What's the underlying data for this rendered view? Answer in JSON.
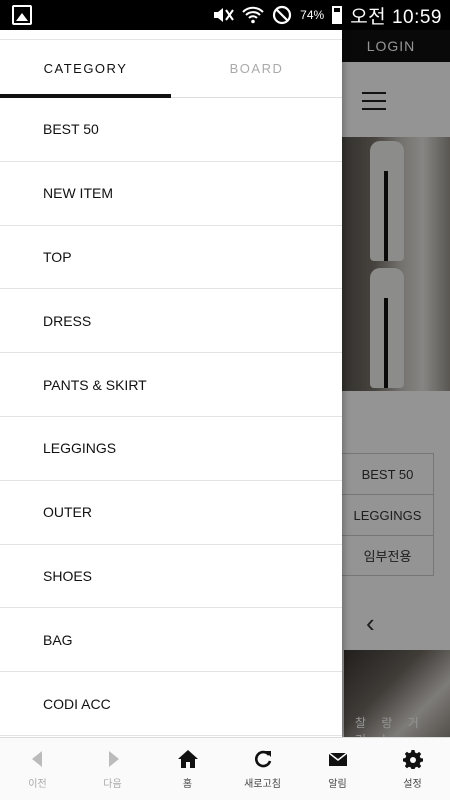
{
  "status_bar": {
    "battery_pct": "74%",
    "time": "오전 10:59"
  },
  "background_page": {
    "login_label": "LOGIN",
    "categories": [
      "BEST 50",
      "LEGGINGS",
      "임부전용"
    ],
    "banner_text": "찰 랑 거 리 는"
  },
  "drawer": {
    "tabs": [
      {
        "label": "CATEGORY",
        "active": true
      },
      {
        "label": "BOARD",
        "active": false
      }
    ],
    "items": [
      {
        "label": "BEST 50"
      },
      {
        "label": "NEW ITEM"
      },
      {
        "label": "TOP"
      },
      {
        "label": "DRESS"
      },
      {
        "label": "PANTS & SKIRT"
      },
      {
        "label": "LEGGINGS"
      },
      {
        "label": "OUTER"
      },
      {
        "label": "SHOES"
      },
      {
        "label": "BAG"
      },
      {
        "label": "CODI ACC"
      }
    ]
  },
  "bottom_nav": {
    "items": [
      {
        "label": "이전",
        "icon": "back-arrow-icon"
      },
      {
        "label": "다음",
        "icon": "forward-arrow-icon"
      },
      {
        "label": "홈",
        "icon": "home-icon"
      },
      {
        "label": "새로고침",
        "icon": "refresh-icon"
      },
      {
        "label": "알림",
        "icon": "mail-icon"
      },
      {
        "label": "설정",
        "icon": "gear-icon"
      }
    ]
  }
}
